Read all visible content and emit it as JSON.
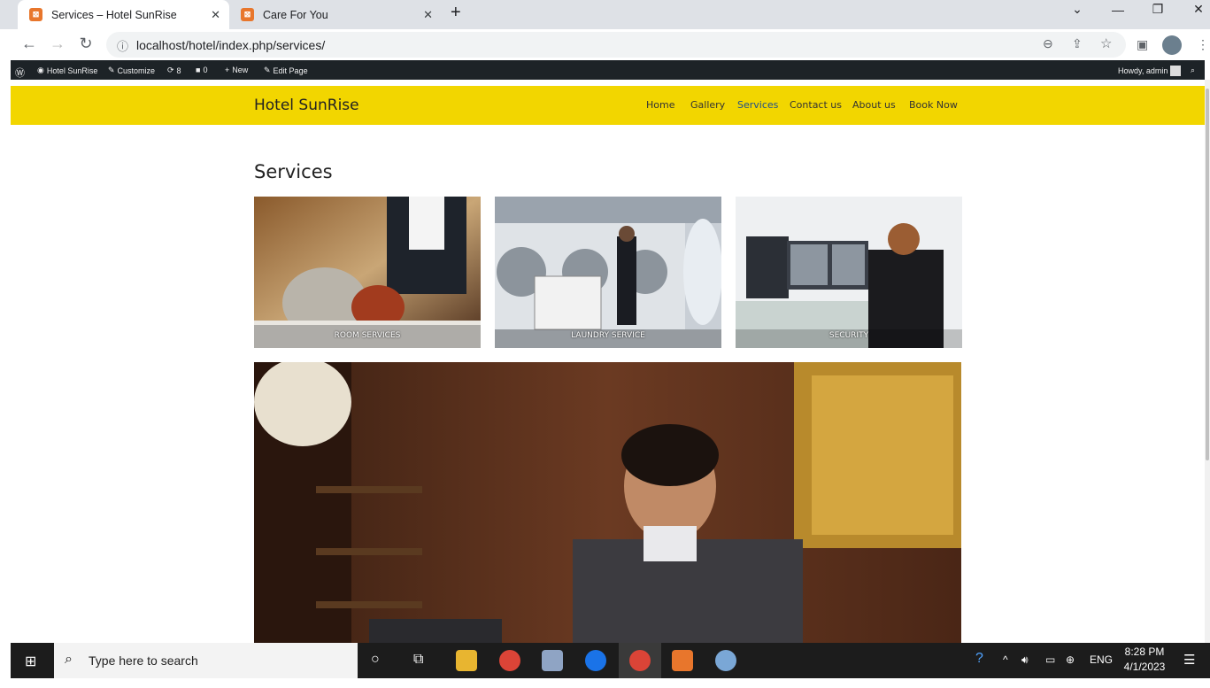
{
  "browser": {
    "tabs": [
      {
        "title": "Services – Hotel SunRise",
        "active": true
      },
      {
        "title": "Care For You",
        "active": false
      }
    ],
    "new_tab": "+",
    "url": "localhost/hotel/index.php/services/"
  },
  "wp_admin_bar": {
    "site": "Hotel SunRise",
    "customize": "Customize",
    "updates": "8",
    "comments": "0",
    "new": "New",
    "edit": "Edit Page",
    "howdy": "Howdy, admin"
  },
  "site": {
    "brand": "Hotel SunRise",
    "nav": [
      "Home",
      "Gallery",
      "Services",
      "Contact us",
      "About us",
      "Book Now"
    ],
    "current_nav": "Services"
  },
  "content": {
    "title": "Services",
    "cards": [
      {
        "caption": "ROOM SERVICES"
      },
      {
        "caption": "LAUNDRY SERVICE"
      },
      {
        "caption": "SECURITY"
      }
    ]
  },
  "taskbar": {
    "search_placeholder": "Type here to search",
    "lang": "ENG",
    "time": "8:28 PM",
    "date": "4/1/2023"
  },
  "colors": {
    "header": "#f2d600",
    "wpbar": "#1d2327",
    "accent_nav": "#1e4e8c"
  }
}
